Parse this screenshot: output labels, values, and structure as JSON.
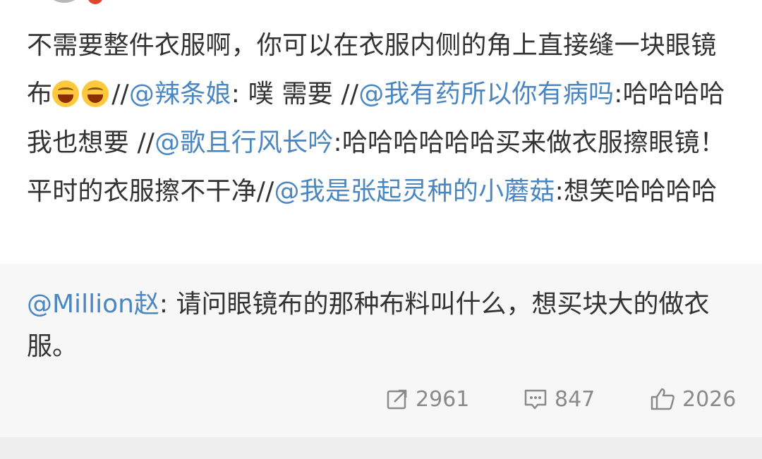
{
  "post": {
    "segments": [
      {
        "text": "不需要整件衣服啊，你可以在衣服内侧的角上直接缝一块眼镜布",
        "type": "text"
      },
      {
        "text": "//",
        "type": "text"
      },
      {
        "text": "@辣条娘",
        "type": "mention"
      },
      {
        "text": ": 噗 需要 //",
        "type": "text"
      },
      {
        "text": "@我有药所以你有病吗",
        "type": "mention"
      },
      {
        "text": ":哈哈哈哈我也想要 //",
        "type": "text"
      },
      {
        "text": "@歌且行风长吟",
        "type": "mention"
      },
      {
        "text": ":哈哈哈哈哈哈买来做衣服擦眼镜！平时的衣服擦不干净//",
        "type": "text"
      },
      {
        "text": "@我是张起灵种的小蘑菇",
        "type": "mention"
      },
      {
        "text": ":想笑哈哈哈哈",
        "type": "text"
      }
    ],
    "emojis": [
      "laugh-cry-emoji",
      "laugh-cry-emoji"
    ]
  },
  "retweet": {
    "mention": "@Million赵",
    "text": ": 请问眼镜布的那种布料叫什么，想买块大的做衣服。"
  },
  "stats": {
    "reposts": "2961",
    "comments": "847",
    "likes": "2026"
  },
  "colors": {
    "mention": "#4a86c2",
    "text": "#333333",
    "muted": "#8a8a8a",
    "retweet_bg": "#f7f7f7"
  }
}
